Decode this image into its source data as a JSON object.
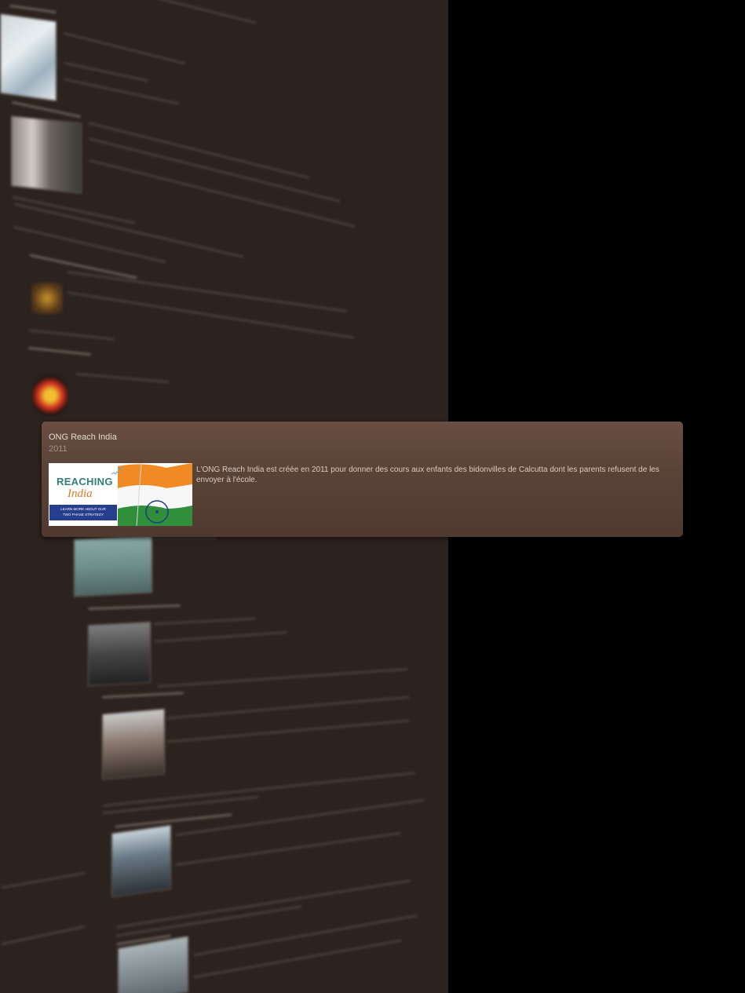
{
  "card": {
    "title": "ONG Reach India",
    "year": "2011",
    "description": "L'ONG Reach India est créée en 2011 pour donner des cours aux enfants des bidonvilles de Calcutta dont les parents refusent de les envoyer à l'école.",
    "image": {
      "title": "REACHING",
      "subtitle": "India",
      "banner_line1": "LEARN MORE ABOUT OUR",
      "banner_line2": "TWO PHASE STRATEGY"
    }
  },
  "colors": {
    "card_top": "#6a4f43",
    "card_bottom": "#503a30",
    "page_bg": "#2c221e",
    "outside_bg": "#000000"
  }
}
